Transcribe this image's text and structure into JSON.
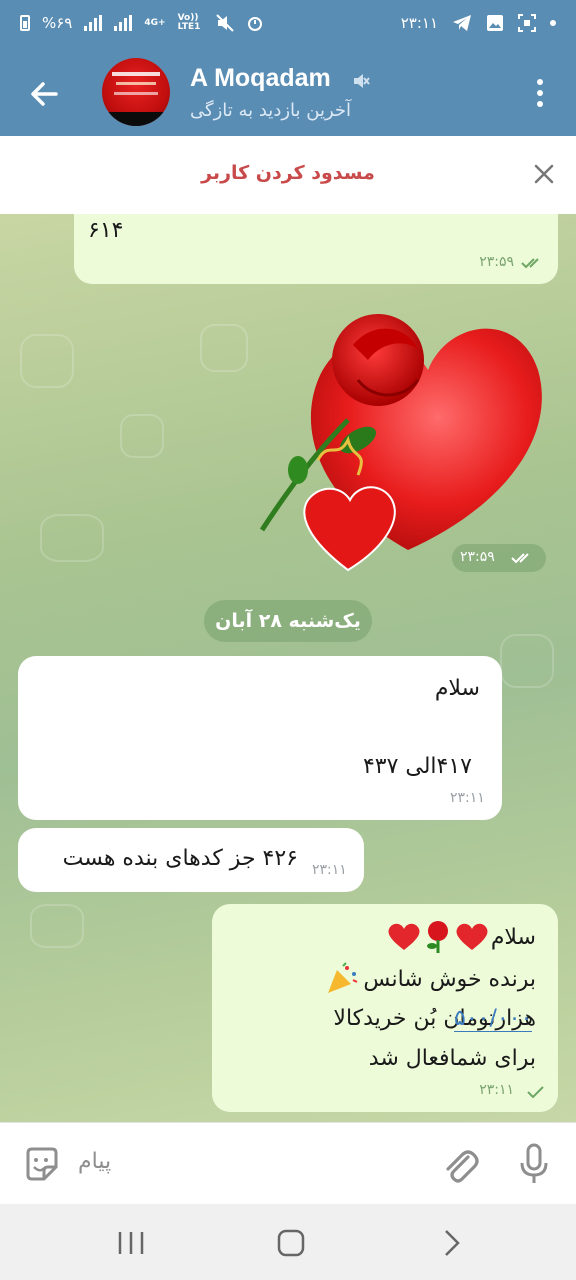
{
  "status_bar": {
    "battery": "%۶۹",
    "net_tag_1": "4G+",
    "net_tag_2": "Vo)) LTE1",
    "time": "۲۳:۱۱"
  },
  "header": {
    "contact_name": "A Moqadam",
    "last_seen": "آخرین بازدید به تازگی"
  },
  "block_bar": {
    "label": "مسدود کردن کاربر"
  },
  "messages": {
    "m1": {
      "text": "۶۱۴",
      "time": "۲۳:۵۹"
    },
    "sticker": {
      "time": "۲۳:۵۹"
    },
    "date_divider": "یک‌شنبه ۲۸ آبان",
    "m2": {
      "line1": "سلام",
      "line2": "۴۱۷الی ۴۳۷",
      "time": "۲۳:۱۱"
    },
    "m3": {
      "text": "۴۲۶ جز کدهای بنده هست",
      "time": "۲۳:۱۱"
    },
    "m4": {
      "line1": "سلام",
      "line2": "برنده خوش شانس",
      "line3_link": "۵۰۰/۰۰۰",
      "line3_rest": " هزارتومان بُن خریدکالا",
      "line4": "برای شمافعال شد",
      "time": "۲۳:۱۱"
    }
  },
  "composer": {
    "placeholder": "پیام"
  },
  "colors": {
    "header_bg": "#5a8db4",
    "out_bubble": "#eefbd9",
    "in_bubble": "#ffffff",
    "block_text": "#c94a4a",
    "link": "#3a7bbf"
  }
}
